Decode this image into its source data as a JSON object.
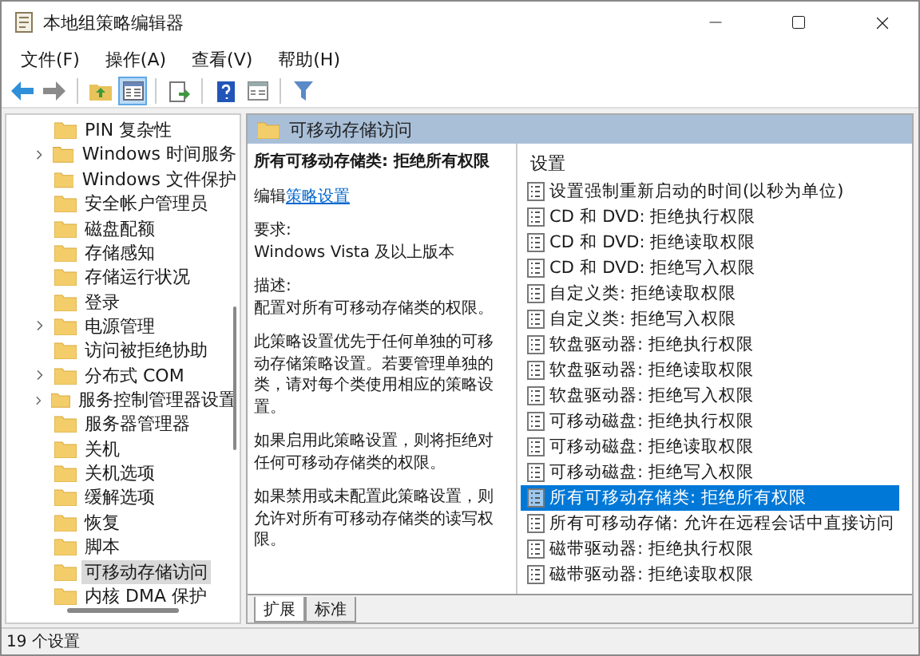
{
  "window": {
    "title": "本地组策略编辑器"
  },
  "menu": [
    {
      "label": "文件(F)"
    },
    {
      "label": "操作(A)"
    },
    {
      "label": "查看(V)"
    },
    {
      "label": "帮助(H)"
    }
  ],
  "toolbar": [
    {
      "kind": "back",
      "pressed": false
    },
    {
      "kind": "forward",
      "pressed": false
    },
    {
      "kind": "separator"
    },
    {
      "kind": "up",
      "pressed": false
    },
    {
      "kind": "tree",
      "pressed": true
    },
    {
      "kind": "separator"
    },
    {
      "kind": "export",
      "pressed": false
    },
    {
      "kind": "separator"
    },
    {
      "kind": "help",
      "pressed": false
    },
    {
      "kind": "view",
      "pressed": false
    },
    {
      "kind": "separator"
    },
    {
      "kind": "filter",
      "pressed": false
    }
  ],
  "tree": {
    "items": [
      {
        "label": "PIN 复杂性",
        "expandable": false,
        "selected": false
      },
      {
        "label": "Windows 时间服务",
        "expandable": true,
        "selected": false
      },
      {
        "label": "Windows 文件保护",
        "expandable": false,
        "selected": false
      },
      {
        "label": "安全帐户管理员",
        "expandable": false,
        "selected": false
      },
      {
        "label": "磁盘配额",
        "expandable": false,
        "selected": false
      },
      {
        "label": "存储感知",
        "expandable": false,
        "selected": false
      },
      {
        "label": "存储运行状况",
        "expandable": false,
        "selected": false
      },
      {
        "label": "登录",
        "expandable": false,
        "selected": false
      },
      {
        "label": "电源管理",
        "expandable": true,
        "selected": false
      },
      {
        "label": "访问被拒绝协助",
        "expandable": false,
        "selected": false
      },
      {
        "label": "分布式 COM",
        "expandable": true,
        "selected": false
      },
      {
        "label": "服务控制管理器设置",
        "expandable": true,
        "selected": false
      },
      {
        "label": "服务器管理器",
        "expandable": false,
        "selected": false
      },
      {
        "label": "关机",
        "expandable": false,
        "selected": false
      },
      {
        "label": "关机选项",
        "expandable": false,
        "selected": false
      },
      {
        "label": "缓解选项",
        "expandable": false,
        "selected": false
      },
      {
        "label": "恢复",
        "expandable": false,
        "selected": false
      },
      {
        "label": "脚本",
        "expandable": false,
        "selected": false
      },
      {
        "label": "可移动存储访问",
        "expandable": false,
        "selected": true
      },
      {
        "label": "内核 DMA 保护",
        "expandable": false,
        "selected": false
      }
    ]
  },
  "header": {
    "title": "可移动存储访问"
  },
  "description": {
    "title": "所有可移动存储类: 拒绝所有权限",
    "edit_prefix": "编辑",
    "edit_link": "策略设置",
    "requirement_label": "要求:",
    "requirement": "Windows Vista 及以上版本",
    "description_label": "描述:",
    "paragraphs": [
      "配置对所有可移动存储类的权限。",
      "此策略设置优先于任何单独的可移动存储策略设置。若要管理单独的类，请对每个类使用相应的策略设置。",
      "如果启用此策略设置，则将拒绝对任何可移动存储类的权限。",
      "如果禁用或未配置此策略设置，则允许对所有可移动存储类的读写权限。"
    ]
  },
  "settings": {
    "column": "设置",
    "items": [
      {
        "label": "设置强制重新启动的时间(以秒为单位)",
        "selected": false
      },
      {
        "label": "CD 和 DVD: 拒绝执行权限",
        "selected": false
      },
      {
        "label": "CD 和 DVD: 拒绝读取权限",
        "selected": false
      },
      {
        "label": "CD 和 DVD: 拒绝写入权限",
        "selected": false
      },
      {
        "label": "自定义类: 拒绝读取权限",
        "selected": false
      },
      {
        "label": "自定义类: 拒绝写入权限",
        "selected": false
      },
      {
        "label": "软盘驱动器: 拒绝执行权限",
        "selected": false
      },
      {
        "label": "软盘驱动器: 拒绝读取权限",
        "selected": false
      },
      {
        "label": "软盘驱动器: 拒绝写入权限",
        "selected": false
      },
      {
        "label": "可移动磁盘: 拒绝执行权限",
        "selected": false
      },
      {
        "label": "可移动磁盘: 拒绝读取权限",
        "selected": false
      },
      {
        "label": "可移动磁盘: 拒绝写入权限",
        "selected": false
      },
      {
        "label": "所有可移动存储类: 拒绝所有权限",
        "selected": true
      },
      {
        "label": "所有可移动存储: 允许在远程会话中直接访问",
        "selected": false
      },
      {
        "label": "磁带驱动器: 拒绝执行权限",
        "selected": false
      },
      {
        "label": "磁带驱动器: 拒绝读取权限",
        "selected": false
      }
    ]
  },
  "tabs": [
    {
      "label": "扩展",
      "selected": true
    },
    {
      "label": "标准",
      "selected": false
    }
  ],
  "status_bar": {
    "text": "19 个设置"
  }
}
